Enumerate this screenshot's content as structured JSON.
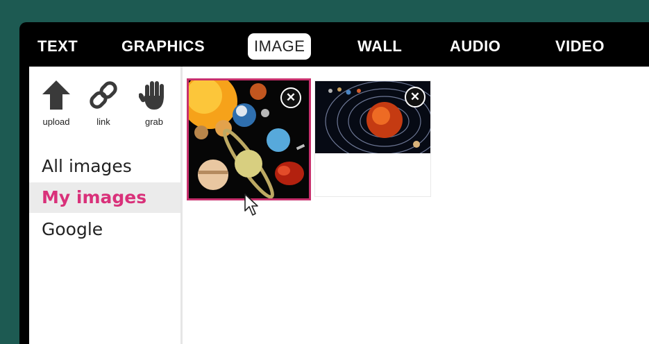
{
  "tabs": [
    {
      "label": "TEXT",
      "active": false
    },
    {
      "label": "GRAPHICS",
      "active": false
    },
    {
      "label": "IMAGE",
      "active": true
    },
    {
      "label": "WALL",
      "active": false
    },
    {
      "label": "AUDIO",
      "active": false
    },
    {
      "label": "VIDEO",
      "active": false
    }
  ],
  "tools": [
    {
      "label": "upload",
      "icon": "upload-arrow-icon"
    },
    {
      "label": "link",
      "icon": "link-chain-icon"
    },
    {
      "label": "grab",
      "icon": "grab-hand-icon"
    }
  ],
  "sources": [
    {
      "label": "All images",
      "selected": false
    },
    {
      "label": "My images",
      "selected": true
    },
    {
      "label": "Google",
      "selected": false
    }
  ],
  "images": [
    {
      "subject": "planets collage",
      "selected": true,
      "remove_glyph": "✕"
    },
    {
      "subject": "solar system orbits",
      "selected": false,
      "remove_glyph": "✕"
    }
  ],
  "colors": {
    "accent": "#d9317a",
    "selection_border": "#c8306d",
    "frame_bg": "#000000",
    "outer_bg": "#1d5a52"
  }
}
